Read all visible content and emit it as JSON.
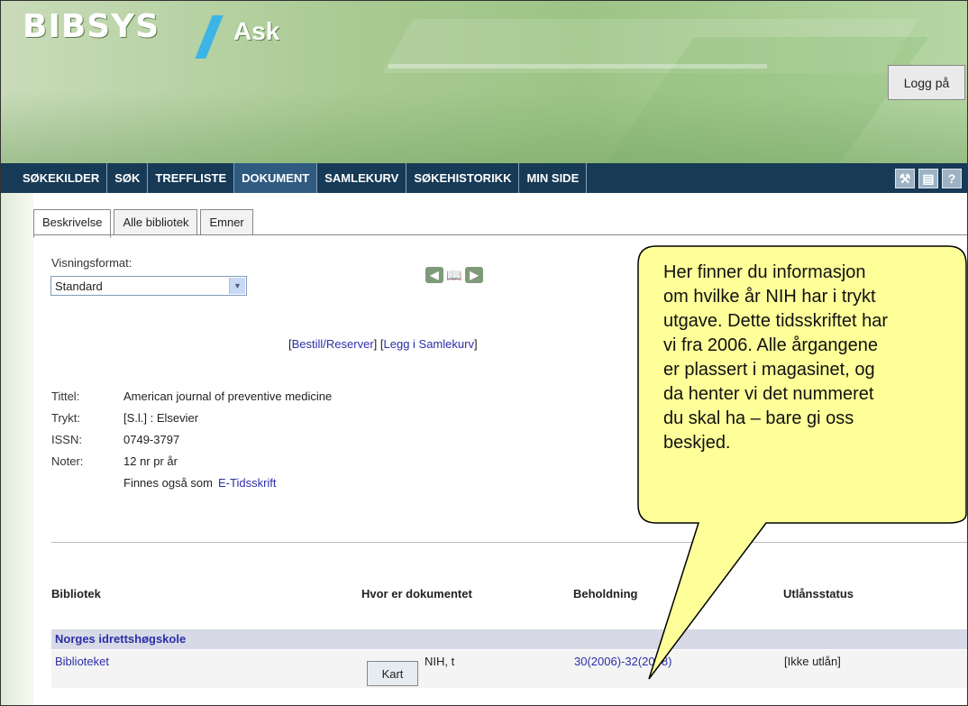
{
  "header": {
    "logo": "BIBSYS",
    "app_name": "Ask",
    "login_label": "Logg på"
  },
  "nav": {
    "items": [
      {
        "label": "SØKEKILDER"
      },
      {
        "label": "SØK"
      },
      {
        "label": "TREFFLISTE"
      },
      {
        "label": "DOKUMENT",
        "active": true
      },
      {
        "label": "SAMLEKURV"
      },
      {
        "label": "SØKEHISTORIKK"
      },
      {
        "label": "MIN SIDE"
      }
    ],
    "icons": [
      "tools-icon",
      "print-icon",
      "help-icon"
    ]
  },
  "tabs": [
    {
      "label": "Beskrivelse",
      "active": true
    },
    {
      "label": "Alle bibliotek"
    },
    {
      "label": "Emner"
    }
  ],
  "format": {
    "label": "Visningsformat:",
    "selected": "Standard"
  },
  "actions": {
    "bestill": "Bestill/Reserver",
    "legg": "Legg i Samlekurv"
  },
  "record": {
    "title_key": "Tittel:",
    "title": "American journal of preventive medicine",
    "printed_key": "Trykt:",
    "printed": "[S.l.] : Elsevier",
    "issn_key": "ISSN:",
    "issn": "0749-3797",
    "notes_key": "Noter:",
    "notes": "12 nr pr år",
    "also_text": "Finnes også som",
    "also_link": "E-Tidsskrift"
  },
  "holdings": {
    "headers": {
      "library": "Bibliotek",
      "location": "Hvor er dokumentet",
      "holding": "Beholdning",
      "status": "Utlånsstatus"
    },
    "institution": "Norges idrettshøgskole",
    "row": {
      "library": "Biblioteket",
      "map_button": "Kart",
      "location": "NIH, t",
      "holding": "30(2006)-32(2008)",
      "status": "[Ikke utlån]"
    }
  },
  "callout": {
    "lines": [
      "Her finner du informasjon",
      "om hvilke år NIH har i trykt",
      "utgave. Dette tidsskriftet har",
      "vi fra 2006. Alle årgangene",
      "er plassert i magasinet, og",
      "da henter vi det nummeret",
      "du skal ha – bare gi oss",
      "beskjed."
    ],
    "fill": "#ffff99",
    "stroke": "#000000"
  }
}
